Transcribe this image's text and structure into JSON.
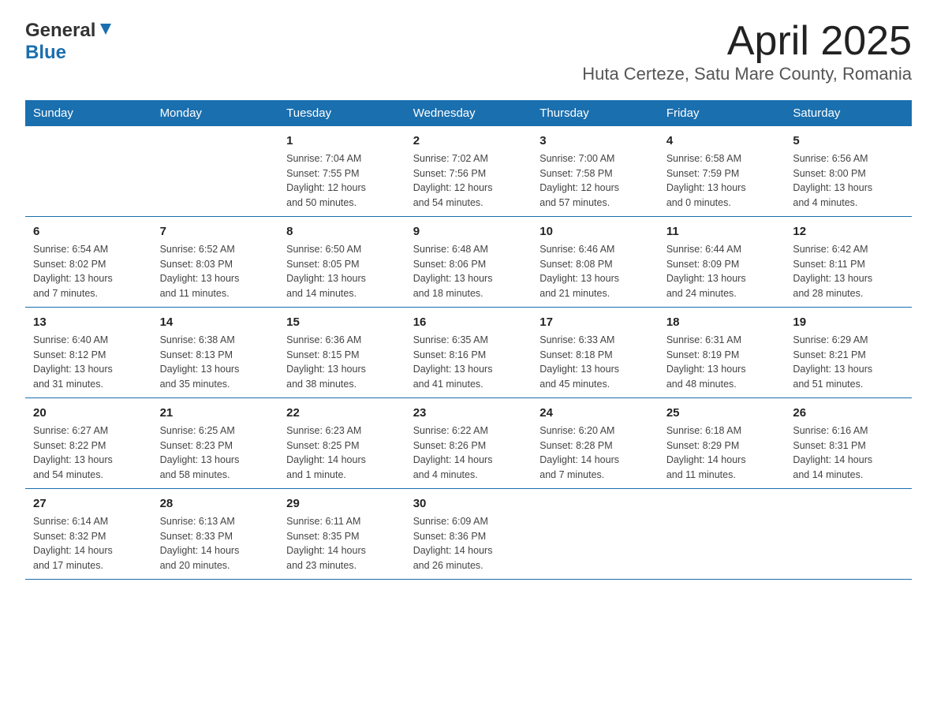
{
  "header": {
    "title": "April 2025",
    "subtitle": "Huta Certeze, Satu Mare County, Romania",
    "logo_general": "General",
    "logo_blue": "Blue"
  },
  "calendar": {
    "days_of_week": [
      "Sunday",
      "Monday",
      "Tuesday",
      "Wednesday",
      "Thursday",
      "Friday",
      "Saturday"
    ],
    "weeks": [
      [
        {
          "day": "",
          "info": ""
        },
        {
          "day": "",
          "info": ""
        },
        {
          "day": "1",
          "info": "Sunrise: 7:04 AM\nSunset: 7:55 PM\nDaylight: 12 hours\nand 50 minutes."
        },
        {
          "day": "2",
          "info": "Sunrise: 7:02 AM\nSunset: 7:56 PM\nDaylight: 12 hours\nand 54 minutes."
        },
        {
          "day": "3",
          "info": "Sunrise: 7:00 AM\nSunset: 7:58 PM\nDaylight: 12 hours\nand 57 minutes."
        },
        {
          "day": "4",
          "info": "Sunrise: 6:58 AM\nSunset: 7:59 PM\nDaylight: 13 hours\nand 0 minutes."
        },
        {
          "day": "5",
          "info": "Sunrise: 6:56 AM\nSunset: 8:00 PM\nDaylight: 13 hours\nand 4 minutes."
        }
      ],
      [
        {
          "day": "6",
          "info": "Sunrise: 6:54 AM\nSunset: 8:02 PM\nDaylight: 13 hours\nand 7 minutes."
        },
        {
          "day": "7",
          "info": "Sunrise: 6:52 AM\nSunset: 8:03 PM\nDaylight: 13 hours\nand 11 minutes."
        },
        {
          "day": "8",
          "info": "Sunrise: 6:50 AM\nSunset: 8:05 PM\nDaylight: 13 hours\nand 14 minutes."
        },
        {
          "day": "9",
          "info": "Sunrise: 6:48 AM\nSunset: 8:06 PM\nDaylight: 13 hours\nand 18 minutes."
        },
        {
          "day": "10",
          "info": "Sunrise: 6:46 AM\nSunset: 8:08 PM\nDaylight: 13 hours\nand 21 minutes."
        },
        {
          "day": "11",
          "info": "Sunrise: 6:44 AM\nSunset: 8:09 PM\nDaylight: 13 hours\nand 24 minutes."
        },
        {
          "day": "12",
          "info": "Sunrise: 6:42 AM\nSunset: 8:11 PM\nDaylight: 13 hours\nand 28 minutes."
        }
      ],
      [
        {
          "day": "13",
          "info": "Sunrise: 6:40 AM\nSunset: 8:12 PM\nDaylight: 13 hours\nand 31 minutes."
        },
        {
          "day": "14",
          "info": "Sunrise: 6:38 AM\nSunset: 8:13 PM\nDaylight: 13 hours\nand 35 minutes."
        },
        {
          "day": "15",
          "info": "Sunrise: 6:36 AM\nSunset: 8:15 PM\nDaylight: 13 hours\nand 38 minutes."
        },
        {
          "day": "16",
          "info": "Sunrise: 6:35 AM\nSunset: 8:16 PM\nDaylight: 13 hours\nand 41 minutes."
        },
        {
          "day": "17",
          "info": "Sunrise: 6:33 AM\nSunset: 8:18 PM\nDaylight: 13 hours\nand 45 minutes."
        },
        {
          "day": "18",
          "info": "Sunrise: 6:31 AM\nSunset: 8:19 PM\nDaylight: 13 hours\nand 48 minutes."
        },
        {
          "day": "19",
          "info": "Sunrise: 6:29 AM\nSunset: 8:21 PM\nDaylight: 13 hours\nand 51 minutes."
        }
      ],
      [
        {
          "day": "20",
          "info": "Sunrise: 6:27 AM\nSunset: 8:22 PM\nDaylight: 13 hours\nand 54 minutes."
        },
        {
          "day": "21",
          "info": "Sunrise: 6:25 AM\nSunset: 8:23 PM\nDaylight: 13 hours\nand 58 minutes."
        },
        {
          "day": "22",
          "info": "Sunrise: 6:23 AM\nSunset: 8:25 PM\nDaylight: 14 hours\nand 1 minute."
        },
        {
          "day": "23",
          "info": "Sunrise: 6:22 AM\nSunset: 8:26 PM\nDaylight: 14 hours\nand 4 minutes."
        },
        {
          "day": "24",
          "info": "Sunrise: 6:20 AM\nSunset: 8:28 PM\nDaylight: 14 hours\nand 7 minutes."
        },
        {
          "day": "25",
          "info": "Sunrise: 6:18 AM\nSunset: 8:29 PM\nDaylight: 14 hours\nand 11 minutes."
        },
        {
          "day": "26",
          "info": "Sunrise: 6:16 AM\nSunset: 8:31 PM\nDaylight: 14 hours\nand 14 minutes."
        }
      ],
      [
        {
          "day": "27",
          "info": "Sunrise: 6:14 AM\nSunset: 8:32 PM\nDaylight: 14 hours\nand 17 minutes."
        },
        {
          "day": "28",
          "info": "Sunrise: 6:13 AM\nSunset: 8:33 PM\nDaylight: 14 hours\nand 20 minutes."
        },
        {
          "day": "29",
          "info": "Sunrise: 6:11 AM\nSunset: 8:35 PM\nDaylight: 14 hours\nand 23 minutes."
        },
        {
          "day": "30",
          "info": "Sunrise: 6:09 AM\nSunset: 8:36 PM\nDaylight: 14 hours\nand 26 minutes."
        },
        {
          "day": "",
          "info": ""
        },
        {
          "day": "",
          "info": ""
        },
        {
          "day": "",
          "info": ""
        }
      ]
    ]
  },
  "colors": {
    "header_bg": "#1a6faf",
    "header_text": "#ffffff",
    "border": "#1a6faf"
  }
}
